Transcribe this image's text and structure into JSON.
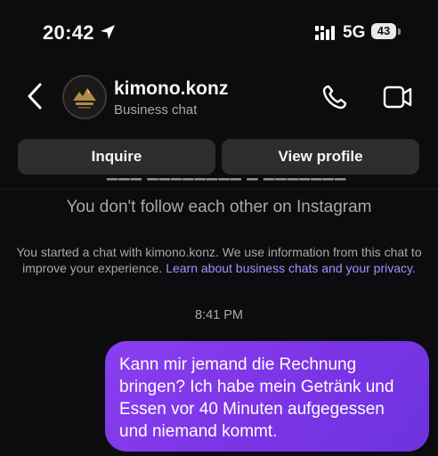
{
  "status_bar": {
    "time": "20:42",
    "network": "5G",
    "battery": "43"
  },
  "header": {
    "contact_name": "kimono.konz",
    "contact_subtitle": "Business chat",
    "avatar_text": "KIMONO"
  },
  "actions": {
    "inquire": "Inquire",
    "view_profile": "View profile"
  },
  "conversation": {
    "follow_note": "You don't follow each other on Instagram",
    "info_note_text": "You started a chat with kimono.konz. We use information from this chat to improve your experience. ",
    "info_note_link": "Learn about business chats and your privacy.",
    "timestamp": "8:41 PM",
    "messages": [
      {
        "sender": "me",
        "text": "Kann mir jemand die Rechnung bringen? Ich habe mein Getränk und Essen vor 40 Minuten aufgegessen und niemand kommt."
      }
    ]
  },
  "colors": {
    "background": "#0c0c0e",
    "button_bg": "#2d2d30",
    "bubble": "#7c3aed",
    "link": "#9c94ff"
  }
}
